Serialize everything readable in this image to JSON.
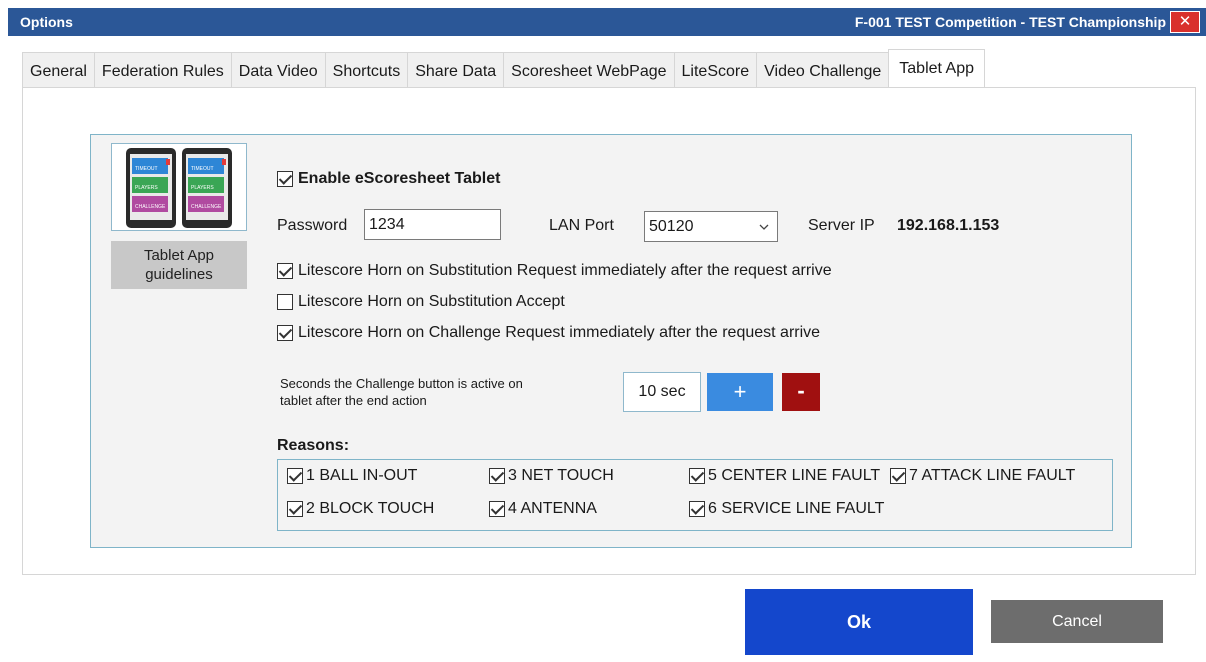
{
  "window": {
    "title": "Options",
    "context": "F-001  TEST Competition - TEST Championship",
    "close_label": "✕"
  },
  "tabs": [
    {
      "label": "General"
    },
    {
      "label": "Federation Rules"
    },
    {
      "label": "Data Video"
    },
    {
      "label": "Shortcuts"
    },
    {
      "label": "Share Data"
    },
    {
      "label": "Scoresheet WebPage"
    },
    {
      "label": "LiteScore"
    },
    {
      "label": "Video Challenge"
    },
    {
      "label": "Tablet App",
      "active": true
    }
  ],
  "tablet": {
    "guidelines_label_1": "Tablet App",
    "guidelines_label_2": "guidelines",
    "thumb_buttons": [
      "TIMEOUT",
      "PLAYERS",
      "CHALLENGE"
    ],
    "enable_label": "Enable eScoresheet Tablet",
    "enable_checked": true,
    "password_label": "Password",
    "password_value": "1234",
    "lan_port_label": "LAN Port",
    "lan_port_value": "50120",
    "server_ip_label": "Server IP",
    "server_ip_value": "192.168.1.153",
    "horn_sub_request_label": "Litescore Horn on Substitution Request immediately after the request arrive",
    "horn_sub_request_checked": true,
    "horn_sub_accept_label": "Litescore Horn on Substitution Accept",
    "horn_sub_accept_checked": false,
    "horn_challenge_label": "Litescore Horn on Challenge Request immediately after the request arrive",
    "horn_challenge_checked": true,
    "seconds_note_1": "Seconds the Challenge button is active on",
    "seconds_note_2": "tablet after the end action",
    "seconds_value": "10 sec",
    "plus_label": "+",
    "minus_label": "-",
    "reasons_title": "Reasons:",
    "reasons": [
      {
        "label": "1 BALL IN-OUT",
        "checked": true
      },
      {
        "label": "2 BLOCK TOUCH",
        "checked": true
      },
      {
        "label": "3 NET TOUCH",
        "checked": true
      },
      {
        "label": "4 ANTENNA",
        "checked": true
      },
      {
        "label": "5 CENTER LINE FAULT",
        "checked": true
      },
      {
        "label": "6 SERVICE LINE FAULT",
        "checked": true
      },
      {
        "label": "7 ATTACK LINE FAULT",
        "checked": true
      }
    ]
  },
  "footer": {
    "ok_label": "Ok",
    "cancel_label": "Cancel"
  },
  "colors": {
    "titlebar": "#2b5797",
    "ok": "#1447cc",
    "plus": "#3a8be0",
    "minus": "#a01010"
  }
}
